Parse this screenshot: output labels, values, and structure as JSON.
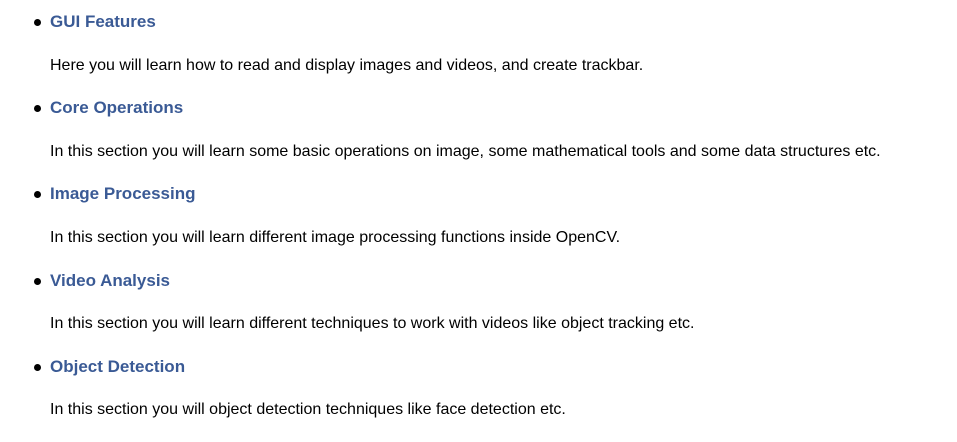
{
  "theme": {
    "link_color": "#3a5a95",
    "text_color": "#000000",
    "bullet_icon": "bullet-dot"
  },
  "sections": [
    {
      "title": "GUI Features",
      "description": "Here you will learn how to read and display images and videos, and create trackbar."
    },
    {
      "title": "Core Operations",
      "description": "In this section you will learn some basic operations on image, some mathematical tools and some data structures etc."
    },
    {
      "title": "Image Processing",
      "description": "In this section you will learn different image processing functions inside OpenCV."
    },
    {
      "title": "Video Analysis",
      "description": "In this section you will learn different techniques to work with videos like object tracking etc."
    },
    {
      "title": "Object Detection",
      "description": "In this section you will object detection techniques like face detection etc."
    }
  ]
}
